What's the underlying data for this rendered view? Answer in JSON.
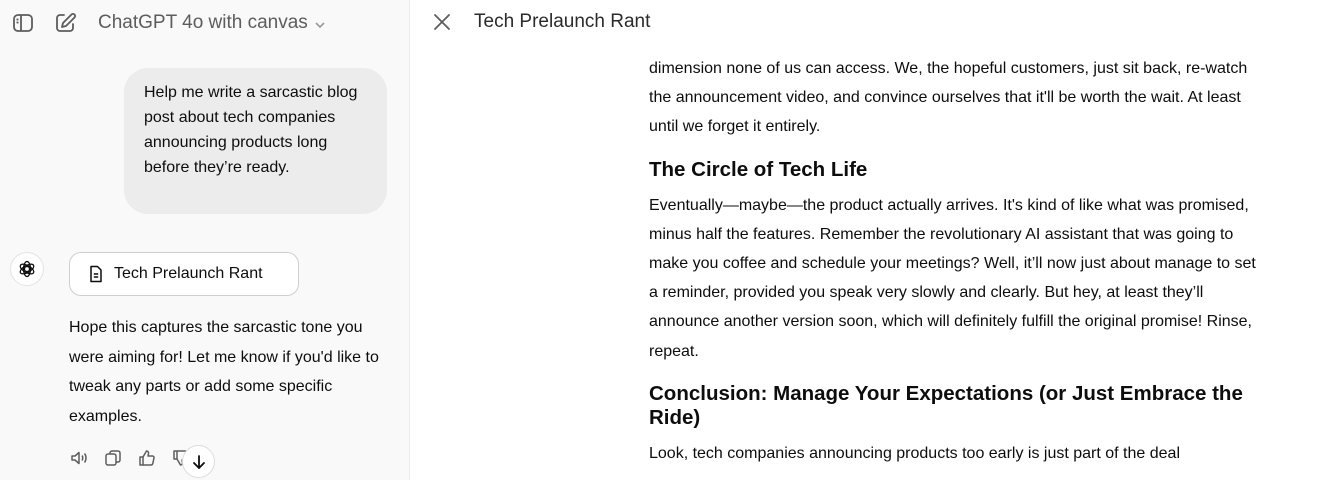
{
  "header": {
    "model_name": "ChatGPT 4o with canvas",
    "sidebar_toggle_icon": "sidebar-icon",
    "new_chat_icon": "compose-icon"
  },
  "chat": {
    "user_message": "Help me write a sarcastic blog post about tech companies announcing products long before they’re ready.",
    "canvas_card_label": "Tech Prelaunch Rant",
    "assistant_message": "Hope this captures the sarcastic tone you were aiming for! Let me know if you'd like to tweak any parts or add some specific examples.",
    "action_icons": [
      "speaker-icon",
      "copy-icon",
      "thumbs-up-icon",
      "thumbs-down-icon"
    ],
    "scroll_icon": "arrow-down-icon"
  },
  "canvas": {
    "title": "Tech Prelaunch Rant",
    "paragraph_1": "dimension none of us can access. We, the hopeful customers, just sit back, re-watch the announcement video, and convince ourselves that it'll be worth the wait. At least until we forget it entirely.",
    "heading_1": "The Circle of Tech Life",
    "paragraph_2": "Eventually—maybe—the product actually arrives. It's kind of like what was promised, minus half the features. Remember the revolutionary AI assistant that was going to make you coffee and schedule your meetings? Well, it’ll now just about manage to set a reminder, provided you speak very slowly and clearly. But hey, at least they’ll announce another version soon, which will definitely fulfill the original promise! Rinse, repeat.",
    "heading_2": "Conclusion: Manage Your Expectations (or Just Embrace the Ride)",
    "paragraph_3": "Look, tech companies announcing products too early is just part of the deal"
  },
  "colors": {
    "left_pane_bg": "#f9f9f9",
    "user_bubble_bg": "#ececec",
    "text": "#0d0d0d",
    "muted_text": "#5d5d5d"
  }
}
